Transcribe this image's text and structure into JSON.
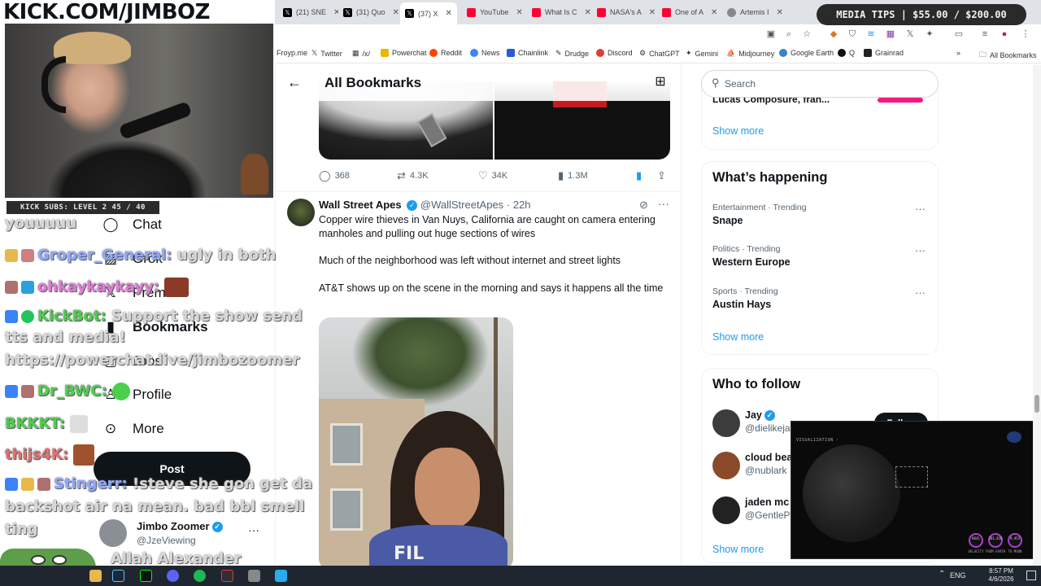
{
  "stream": {
    "url": "KICK.COM/JIMBOZ",
    "subs": "KICK SUBS: LEVEL 2 45 / 40",
    "tips": "MEDIA TIPS | $55.00 / $200.00",
    "chat": [
      {
        "user": "",
        "text": "youuuuu"
      },
      {
        "user": "Groper_General:",
        "text": "ugly in both"
      },
      {
        "user": "ohkaykaykayy:",
        "text": ""
      },
      {
        "user": "KickBot:",
        "text": "Support the show send"
      },
      {
        "user": "",
        "text": "tts and media!"
      },
      {
        "user": "",
        "text": "https://powerchat.live/jimbozoomer"
      },
      {
        "user": "Dr_BWC:",
        "text": ""
      },
      {
        "user": "BKKKT:",
        "text": ""
      },
      {
        "user": "thijs4K:",
        "text": ""
      },
      {
        "user": "Stingerr:",
        "text": "!steve she gon get da"
      },
      {
        "user": "",
        "text": "backshot air na mean. bad bbl smell"
      },
      {
        "user": "",
        "text": "ting"
      },
      {
        "user": "",
        "text": "Allah Alexander"
      }
    ]
  },
  "browser": {
    "tabs": [
      {
        "label": "(21) SNE",
        "icon": "x-icon"
      },
      {
        "label": "(31) Quo",
        "icon": "x-icon"
      },
      {
        "label": "(37) X",
        "icon": "x-icon",
        "active": true
      },
      {
        "label": "YouTube",
        "icon": "youtube-icon"
      },
      {
        "label": "What Is C",
        "icon": "youtube-icon"
      },
      {
        "label": "NASA's A",
        "icon": "youtube-icon"
      },
      {
        "label": "One of A",
        "icon": "youtube-icon"
      },
      {
        "label": "Artemis I",
        "icon": "globe-icon"
      }
    ],
    "bookmarks": [
      "Froyp.me",
      "Twitter",
      "/x/",
      "Powerchat",
      "Reddit",
      "News",
      "Chainlink",
      "Drudge",
      "Discord",
      "ChatGPT",
      "Gemini",
      "Midjourney",
      "Google Earth",
      "Q",
      "Grainrad"
    ],
    "all_bookmarks": "All Bookmarks"
  },
  "nav": {
    "chat": "Chat",
    "grok": "Grok",
    "premium": "Premium",
    "bookmarks": "Bookmarks",
    "jobs": "Jobs",
    "profile": "Profile",
    "more": "More",
    "post": "Post",
    "account_name": "Jimbo Zoomer",
    "account_handle": "@JzeViewing"
  },
  "main": {
    "title": "All Bookmarks",
    "prev_actions": {
      "replies": "368",
      "reposts": "4.3K",
      "likes": "34K",
      "views": "1.3M"
    },
    "tweet": {
      "name": "Wall Street Apes",
      "handle": "@WallStreetApes",
      "time": "· 22h",
      "p1": "Copper wire thieves in Van Nuys, California are caught on camera entering manholes and pulling out huge sections of wires",
      "p2": "Much of the neighborhood was left without internet and street lights",
      "p3": "AT&T shows up on the scene in the morning and says it happens all the time",
      "media_text": "FIL"
    }
  },
  "sidebar": {
    "search_placeholder": "Search",
    "top_cut": "Lucas Composure, fran...",
    "show_more": "Show more",
    "happening_title": "What’s happening",
    "trends": [
      {
        "meta": "Entertainment · Trending",
        "topic": "Snape"
      },
      {
        "meta": "Politics · Trending",
        "topic": "Western Europe"
      },
      {
        "meta": "Sports · Trending",
        "topic": "Austin Hays"
      }
    ],
    "follow_title": "Who to follow",
    "follow": [
      {
        "name": "Jay",
        "handle": "@dielikeja"
      },
      {
        "name": "cloud bea",
        "handle": "@nublark"
      },
      {
        "name": "jaden mc",
        "handle": "@GentleP"
      }
    ],
    "follow_button": "Follow"
  },
  "pip": {
    "caption": "VISUALIZATION ·",
    "gauges": [
      {
        "value": "8641",
        "label": "VELOCITY"
      },
      {
        "value": "201,816",
        "label": "FROM EARTH"
      },
      {
        "value": "9,453",
        "label": "TO MOON"
      }
    ]
  },
  "taskbar": {
    "lang": "ENG",
    "time": "8:57 PM",
    "date": "4/6/2026"
  },
  "colors": {
    "accent": "#1d9bf0",
    "text": "#0f1419",
    "muted": "#536471"
  }
}
